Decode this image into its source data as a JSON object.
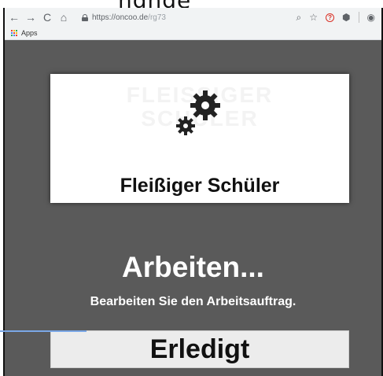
{
  "caption_fragment": "ngnge",
  "browser": {
    "url_host": "https://oncoo.de",
    "url_path": "/rg73",
    "bookmarks": {
      "apps_label": "Apps"
    }
  },
  "card": {
    "ghost_text": "FLEISSIGER SCHÜLER",
    "title": "Fleißiger Schüler"
  },
  "status": {
    "title": "Arbeiten...",
    "subtitle": "Bearbeiten Sie den Arbeitsauftrag."
  },
  "action": {
    "done_label": "Erledigt"
  },
  "colors": {
    "page_background": "#5a5a5a",
    "card_background": "#ffffff",
    "button_background": "#ececec",
    "accent_red": "#d93025"
  },
  "icons": {
    "back": "arrow-left-icon",
    "forward": "arrow-right-icon",
    "reload": "reload-icon",
    "home": "home-icon",
    "lock": "lock-icon",
    "zoom": "zoom-icon",
    "star": "star-icon",
    "extension": "extension-icon",
    "account": "account-icon",
    "gears": "gears-icon"
  }
}
